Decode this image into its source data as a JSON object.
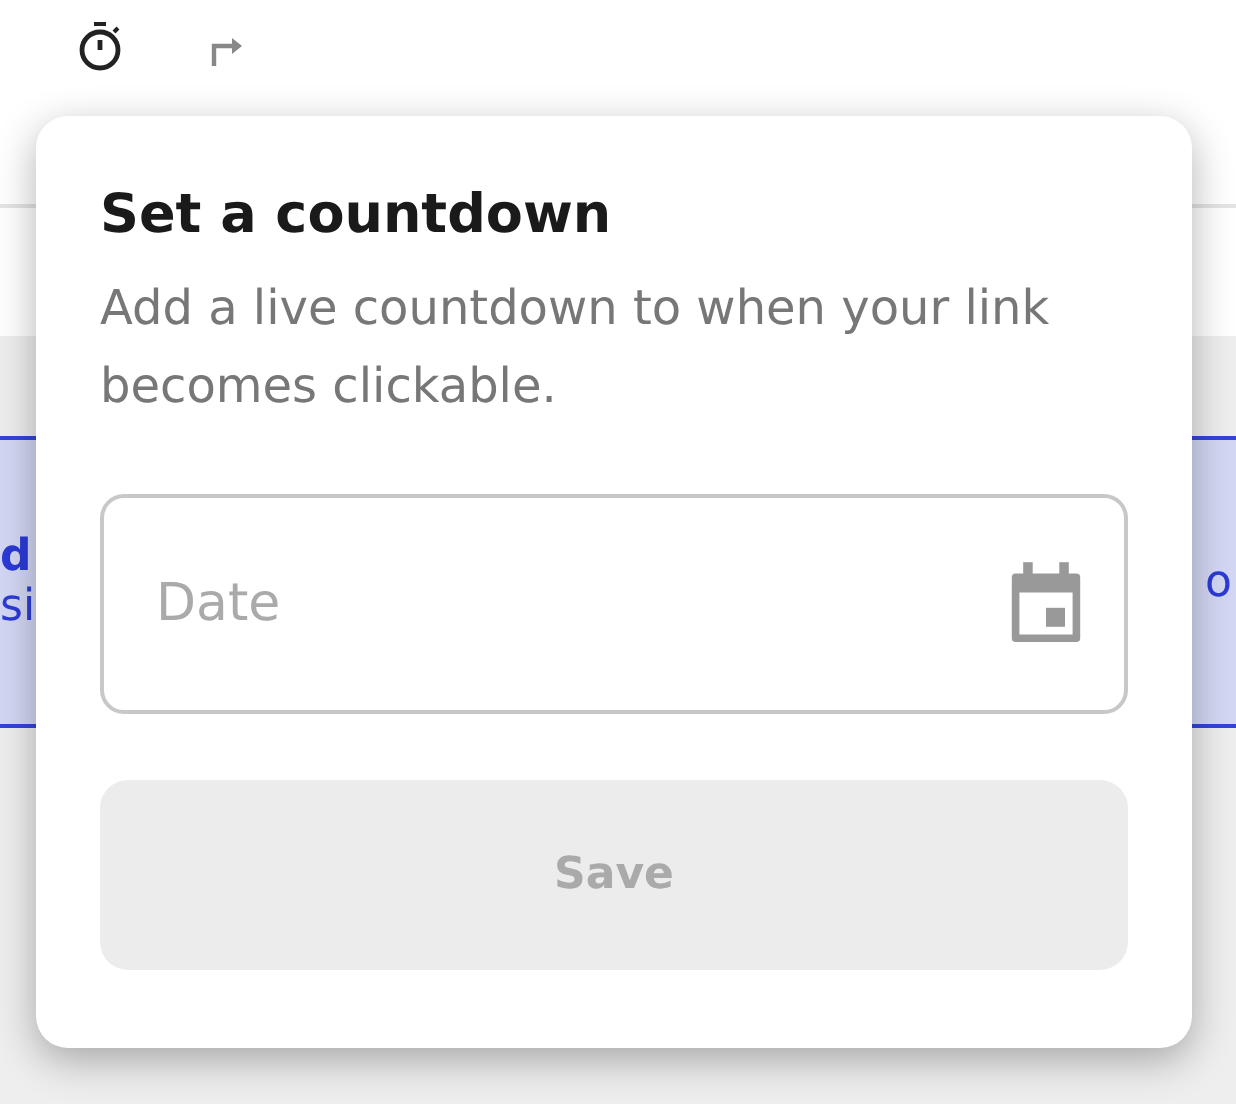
{
  "background_banner": {
    "left_title": "d",
    "left_text": "si",
    "right_text": "o"
  },
  "popover": {
    "title": "Set a countdown",
    "description": "Add a live countdown to when your link becomes clickable.",
    "date_field": {
      "placeholder": "Date"
    },
    "save_button": {
      "label": "Save",
      "disabled": true
    }
  }
}
